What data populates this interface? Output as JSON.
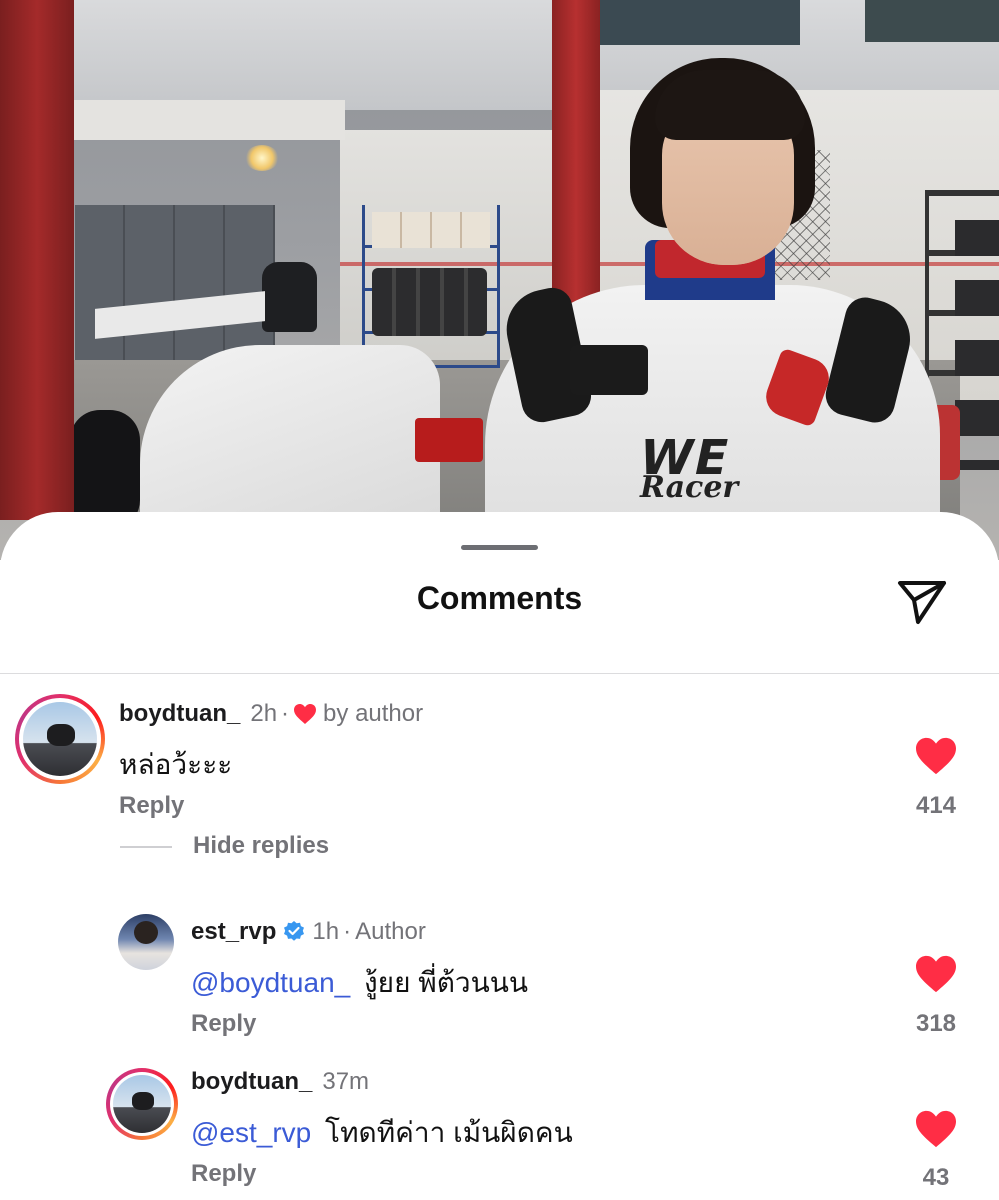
{
  "photo": {
    "jacket_logo": "WE",
    "jacket_sub": "Racer"
  },
  "sheet": {
    "title": "Comments",
    "share_icon": "send-icon"
  },
  "colors": {
    "like_red": "#ff2d45",
    "mention_blue": "#3b5bd6",
    "verified_blue": "#3897f0",
    "muted_text": "#737378"
  },
  "comments": [
    {
      "username": "boydtuan_",
      "time": "2h",
      "liked_by_author_label": "by author",
      "text": "หล่อว้ะะะ",
      "reply_label": "Reply",
      "like_count": "414"
    }
  ],
  "thread": {
    "hide_replies_label": "Hide replies"
  },
  "replies": [
    {
      "username": "est_rvp",
      "verified": true,
      "time": "1h",
      "role": "Author",
      "mention": "@boydtuan_",
      "text": "งู้ยย พี่ต้วนนน",
      "reply_label": "Reply",
      "like_count": "318"
    },
    {
      "username": "boydtuan_",
      "time": "37m",
      "mention": "@est_rvp",
      "text": "โทดทีค่าา เม้นผิดคน",
      "reply_label": "Reply",
      "like_count": "43"
    }
  ]
}
